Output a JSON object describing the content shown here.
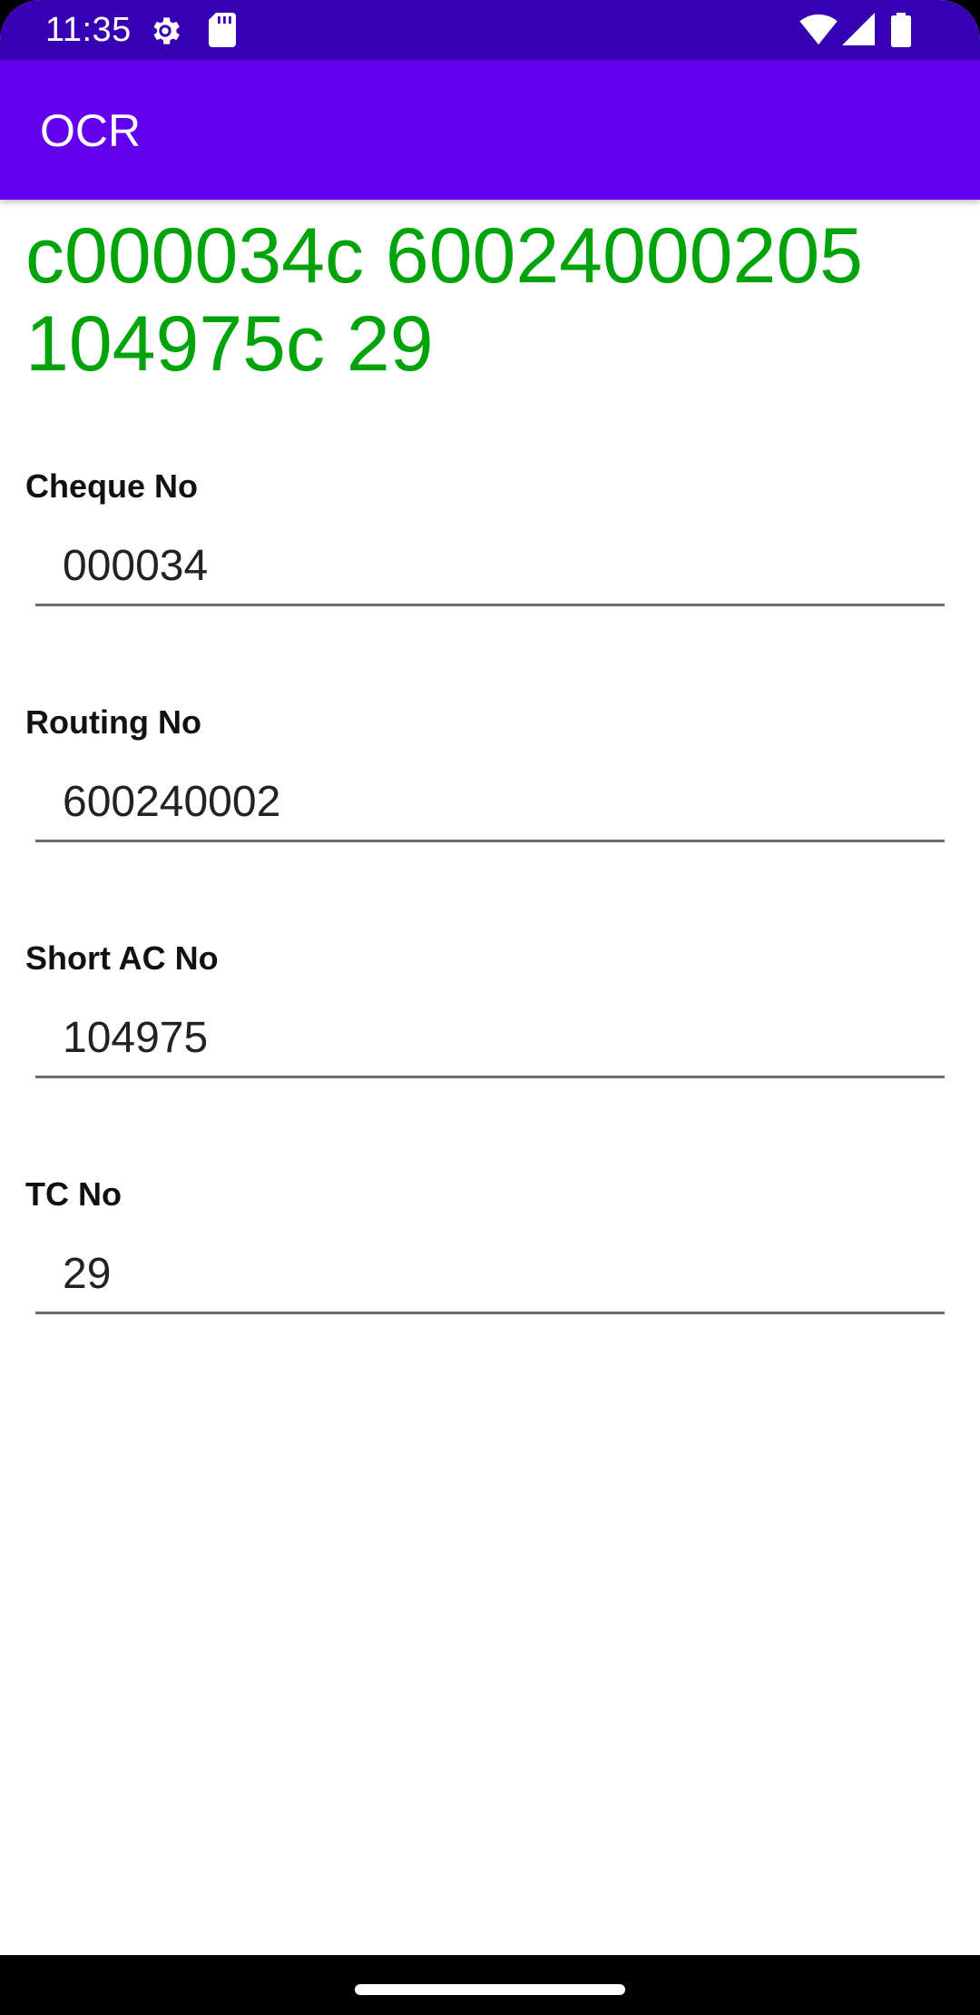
{
  "status_bar": {
    "time": "11:35",
    "icons": [
      "settings-gear-icon",
      "sd-card-icon",
      "wifi-icon",
      "cell-signal-icon",
      "battery-icon"
    ]
  },
  "app_bar": {
    "title": "OCR",
    "color": "#6200ee"
  },
  "ocr_result": {
    "text": "c000034c 60024000205 104975c 29",
    "color": "#00a40a"
  },
  "fields": {
    "cheque_no": {
      "label": "Cheque No",
      "value": "000034"
    },
    "routing_no": {
      "label": "Routing No",
      "value": "600240002"
    },
    "short_ac_no": {
      "label": "Short AC No",
      "value": "104975"
    },
    "tc_no": {
      "label": "TC No",
      "value": "29"
    }
  }
}
